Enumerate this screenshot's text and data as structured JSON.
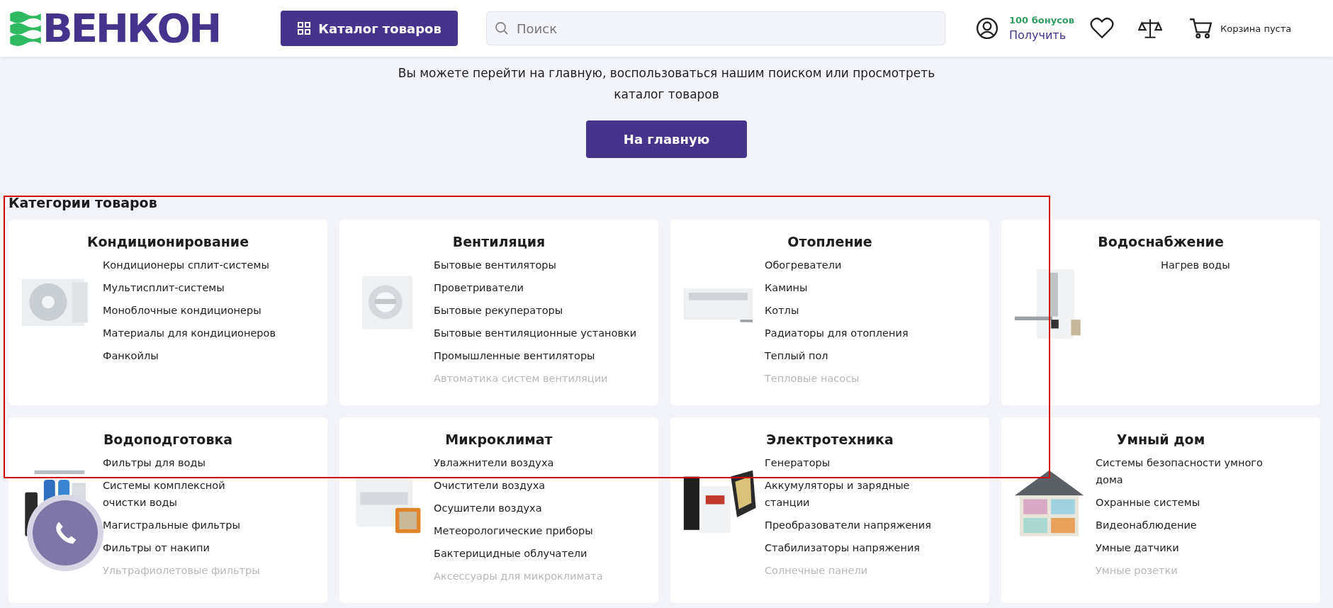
{
  "header": {
    "logo": "ВЕНКОН",
    "catalog_button": "Каталог товаров",
    "search": {
      "placeholder": "Поиск"
    },
    "bonus": {
      "amount": "100 бонусов",
      "action": "Получить"
    },
    "cart": "Корзина пуста"
  },
  "message": {
    "text": "Вы можете перейти на главную, воспользоваться нашим поиском или просмотреть каталог товаров",
    "button": "На главную"
  },
  "categories": {
    "title": "Категории товаров",
    "annotation": {
      "kind": "frame"
    },
    "cards": [
      {
        "title": "Кондиционирование",
        "image": {
          "kind": "picture"
        },
        "items": [
          {
            "label": "Кондиционеры сплит-системы",
            "faded": false
          },
          {
            "label": "Мультисплит-системы",
            "faded": false
          },
          {
            "label": "Моноблочные кондиционеры",
            "faded": false
          },
          {
            "label": "Материалы для кондиционеров",
            "faded": false
          },
          {
            "label": "Фанкойлы",
            "faded": false
          }
        ]
      },
      {
        "title": "Вентиляция",
        "image": {
          "kind": "picture"
        },
        "items": [
          {
            "label": "Бытовые вентиляторы",
            "faded": false
          },
          {
            "label": "Проветриватели",
            "faded": false
          },
          {
            "label": "Бытовые рекуператоры",
            "faded": false
          },
          {
            "label": "Бытовые вентиляционные установки",
            "faded": false
          },
          {
            "label": "Промышленные вентиляторы",
            "faded": false
          },
          {
            "label": "Автоматика систем вентиляции",
            "faded": true
          }
        ]
      },
      {
        "title": "Отопление",
        "image": {
          "kind": "picture"
        },
        "items": [
          {
            "label": "Обогреватели",
            "faded": false
          },
          {
            "label": "Камины",
            "faded": false
          },
          {
            "label": "Котлы",
            "faded": false
          },
          {
            "label": "Радиаторы для отопления",
            "faded": false
          },
          {
            "label": "Теплый пол",
            "faded": false
          },
          {
            "label": "Тепловые насосы",
            "faded": true
          }
        ]
      },
      {
        "title": "Водоснабжение",
        "image": {
          "kind": "picture"
        },
        "items": [
          {
            "label": "Нагрев воды",
            "faded": false
          }
        ]
      },
      {
        "title": "Водоподготовка",
        "image": {
          "kind": "picture"
        },
        "items": [
          {
            "label": "Фильтры для воды",
            "faded": false
          },
          {
            "label": "Системы комплексной очистки воды",
            "faded": false
          },
          {
            "label": "Магистральные фильтры",
            "faded": false
          },
          {
            "label": "Фильтры от накипи",
            "faded": false
          },
          {
            "label": "Ультрафиолетовые фильтры",
            "faded": true
          }
        ]
      },
      {
        "title": "Микроклимат",
        "image": {
          "kind": "picture"
        },
        "items": [
          {
            "label": "Увлажнители воздуха",
            "faded": false
          },
          {
            "label": "Очистители воздуха",
            "faded": false
          },
          {
            "label": "Осушители воздуха",
            "faded": false
          },
          {
            "label": "Метеорологические приборы",
            "faded": false
          },
          {
            "label": "Бактерицидные облучатели",
            "faded": false
          },
          {
            "label": "Аксессуары для микроклимата",
            "faded": true
          }
        ]
      },
      {
        "title": "Электротехника",
        "image": {
          "kind": "picture"
        },
        "items": [
          {
            "label": "Генераторы",
            "faded": false
          },
          {
            "label": "Аккумуляторы и зарядные станции",
            "faded": false
          },
          {
            "label": "Преобразователи напряжения",
            "faded": false
          },
          {
            "label": "Стабилизаторы напряжения",
            "faded": false
          },
          {
            "label": "Солнечные панели",
            "faded": true
          }
        ]
      },
      {
        "title": "Умный дом",
        "image": {
          "kind": "picture"
        },
        "items": [
          {
            "label": "Системы безопасности умного дома",
            "faded": false
          },
          {
            "label": "Охранные системы",
            "faded": false
          },
          {
            "label": "Видеонаблюдение",
            "faded": false
          },
          {
            "label": "Умные датчики",
            "faded": false
          },
          {
            "label": "Умные розетки",
            "faded": true
          }
        ]
      }
    ]
  },
  "call_button": {
    "kind": "phone"
  }
}
